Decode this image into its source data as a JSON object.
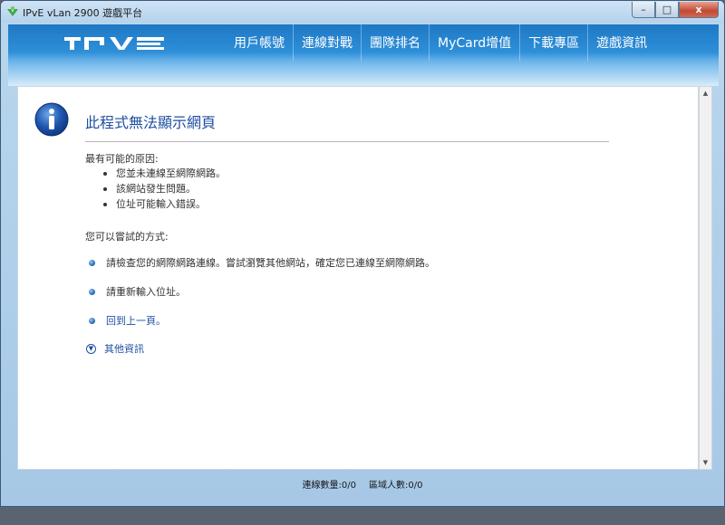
{
  "window": {
    "title": "IPvE vLan 2900 遊戲平台",
    "controls": {
      "minimize": "–",
      "maximize": "□",
      "close": "x"
    }
  },
  "nav": {
    "logo_text": "IPVE",
    "items": [
      {
        "label": "用戶帳號"
      },
      {
        "label": "連線對戰"
      },
      {
        "label": "團隊排名"
      },
      {
        "label": "MyCard增值"
      },
      {
        "label": "下載專區"
      },
      {
        "label": "遊戲資訊"
      }
    ]
  },
  "error_page": {
    "title": "此程式無法顯示網頁",
    "reasons_heading": "最有可能的原因:",
    "reasons": [
      "您並未連線至網際網路。",
      "該網站發生問題。",
      "位址可能輸入錯誤。"
    ],
    "try_heading": "您可以嘗試的方式:",
    "suggestions": [
      {
        "text": "請檢查您的網際網路連線。嘗試瀏覽其他網站，確定您已連線至網際網路。",
        "link": false
      },
      {
        "text": "請重新輸入位址。",
        "link": false
      },
      {
        "text": "回到上一頁。",
        "link": true
      }
    ],
    "more_info": "其他資訊"
  },
  "status": {
    "connections": "連線數量:0/0",
    "area_users": "區域人數:0/0"
  },
  "colors": {
    "nav_blue": "#1e78c4",
    "link_blue": "#1f4fa0",
    "close_red": "#c14a33"
  }
}
